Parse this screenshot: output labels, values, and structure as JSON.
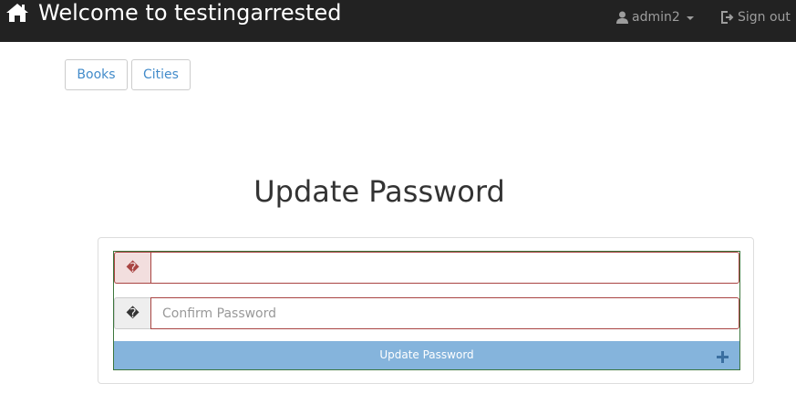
{
  "navbar": {
    "brand": "Welcome to testingarrested",
    "brand_icon": "home-icon",
    "user_label": "admin2",
    "user_icon": "user-icon",
    "signout_label": "Sign out",
    "signout_icon": "sign-out-icon"
  },
  "nav_buttons": {
    "books": "Books",
    "cities": "Cities"
  },
  "form": {
    "title": "Update Password",
    "password": {
      "addon_glyph": "�",
      "value": "",
      "placeholder": ""
    },
    "confirm": {
      "addon_glyph": "�",
      "value": "",
      "placeholder": "Confirm Password"
    },
    "submit_label": "Update Password",
    "submit_icon": "plus-icon"
  },
  "colors": {
    "navbar_bg": "#222222",
    "link": "#428bca",
    "error_border": "#a94442",
    "success_border": "#3c763d",
    "submit_bg": "#85b4dc"
  }
}
